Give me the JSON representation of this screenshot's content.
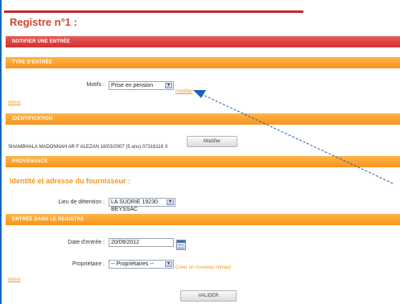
{
  "page": {
    "title": "Registre n°1 :"
  },
  "sections": {
    "notifier": "NOTIFIER UNE ENTRÉE",
    "type_entree": "TYPE D'ENTRÉE",
    "identification": "IDENTIFICATION",
    "provenance": "PROVENANCE",
    "entree_registre": "ENTRÉE DANS LE REGISTRE"
  },
  "type_entree": {
    "motifs_label": "Motifs :",
    "motifs_value": "Prise en pension",
    "modifier_link": "modifier",
    "retour_link": "retour"
  },
  "identification": {
    "animal_text": "SHAMBHALA MADONNAH AR F ALEZAN 18/03/2007 (5 ans) 07316118 X",
    "modifier_button": "Modifier"
  },
  "provenance": {
    "heading": "Identité et adresse du fournisseur :",
    "lieu_label": "Lieu de détention :",
    "lieu_value": "LA SUDRIE 19230 BEYSSAC"
  },
  "entree_registre": {
    "date_label": "Date d'entrée :",
    "date_value": "20/09/2012",
    "proprietaire_label": "Propriétaire :",
    "proprietaire_value": "-- Propriétaires --",
    "create_contact_link": "Créer un nouveau contact",
    "retour_link": "retour",
    "valider_button": "VALIDER"
  },
  "icons": {
    "dropdown": "chevron-down-icon",
    "calendar": "calendar-icon",
    "annotation": "arrow-icon"
  },
  "colors": {
    "title": "#d0462a",
    "red_bar": "#d32f2f",
    "orange_bar": "#f7941d",
    "annotation_arrow": "#1f5fbf"
  }
}
